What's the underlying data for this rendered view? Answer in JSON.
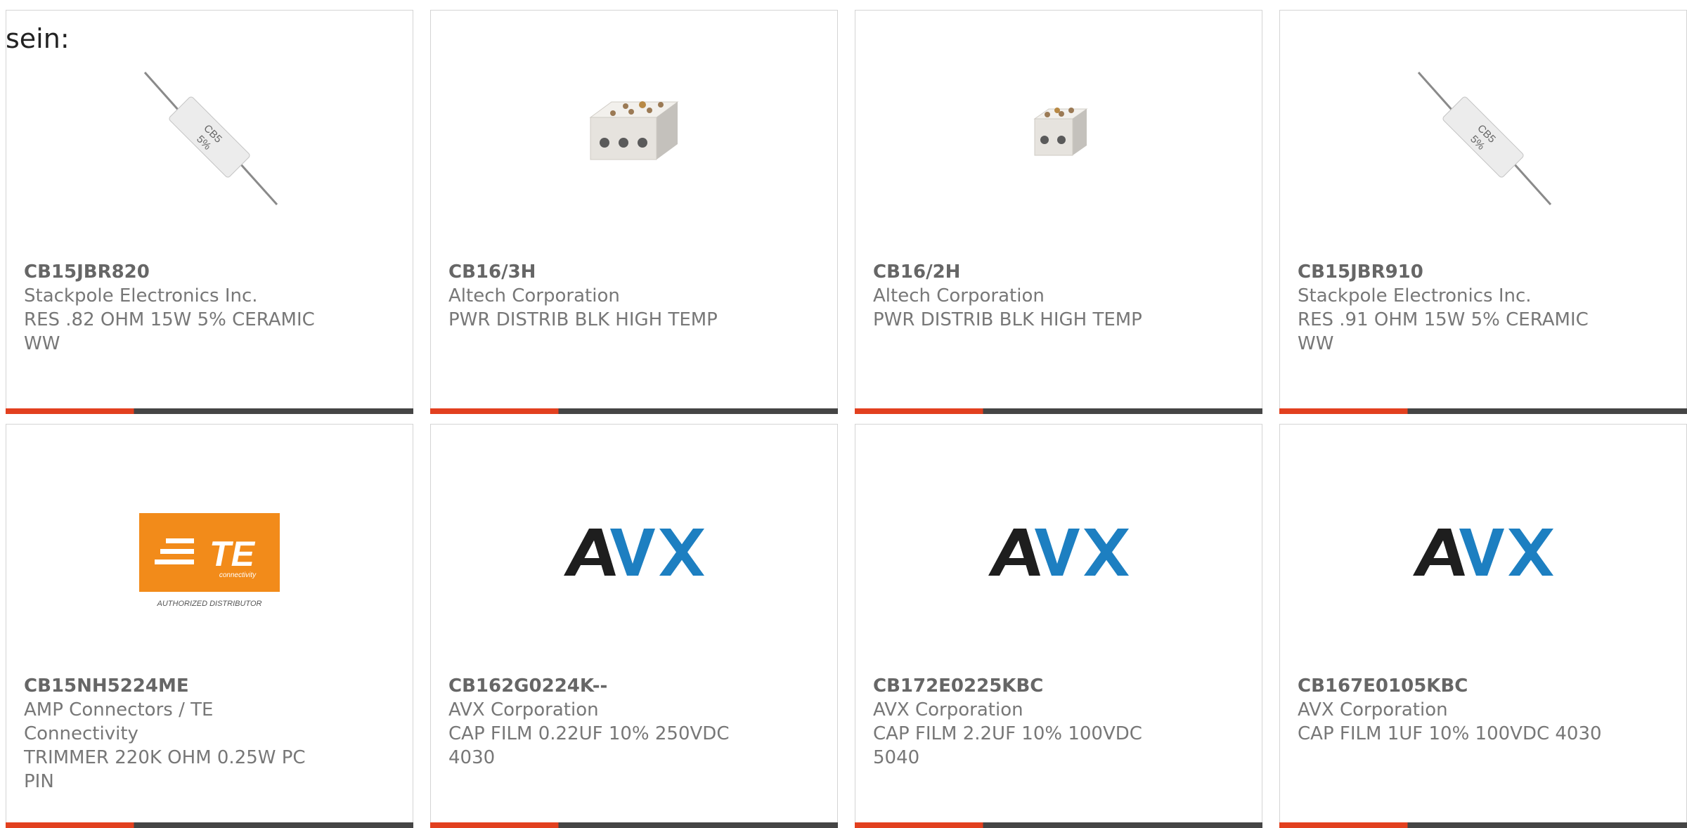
{
  "intro_text": "sein:",
  "colors": {
    "accent": "#e2401f",
    "dark": "#454545",
    "te_orange": "#f28b1a",
    "avx_blue": "#1d7fc1",
    "avx_dark": "#1e1e1e"
  },
  "products": [
    {
      "part_number": "CB15JBR820",
      "manufacturer": "Stackpole Electronics Inc.",
      "description": "RES .82 OHM 15W 5% CERAMIC WW",
      "image": "ceramic-resistor",
      "marking_1": "CB5",
      "marking_2": "5%"
    },
    {
      "part_number": "CB16/3H",
      "manufacturer": "Altech Corporation",
      "description": "PWR DISTRIB BLK HIGH TEMP",
      "image": "terminal-block-3-pole"
    },
    {
      "part_number": "CB16/2H",
      "manufacturer": "Altech Corporation",
      "description": "PWR DISTRIB BLK HIGH TEMP",
      "image": "terminal-block-2-pole"
    },
    {
      "part_number": "CB15JBR910",
      "manufacturer": "Stackpole Electronics Inc.",
      "description": "RES .91 OHM 15W 5% CERAMIC WW",
      "image": "ceramic-resistor",
      "marking_1": "CB5",
      "marking_2": "5%"
    },
    {
      "part_number": "CB15NH5224ME",
      "manufacturer": "AMP Connectors / TE Connectivity",
      "description": "TRIMMER 220K OHM 0.25W PC PIN",
      "image": "te-logo",
      "logo_text": "TE",
      "logo_subtext": "connectivity",
      "logo_caption": "AUTHORIZED DISTRIBUTOR"
    },
    {
      "part_number": "CB162G0224K--",
      "manufacturer": "AVX Corporation",
      "description": "CAP FILM 0.22UF 10% 250VDC 4030",
      "image": "avx-logo"
    },
    {
      "part_number": "CB172E0225KBC",
      "manufacturer": "AVX Corporation",
      "description": "CAP FILM 2.2UF 10% 100VDC 5040",
      "image": "avx-logo"
    },
    {
      "part_number": "CB167E0105KBC",
      "manufacturer": "AVX Corporation",
      "description": "CAP FILM 1UF 10% 100VDC 4030",
      "image": "avx-logo"
    }
  ]
}
